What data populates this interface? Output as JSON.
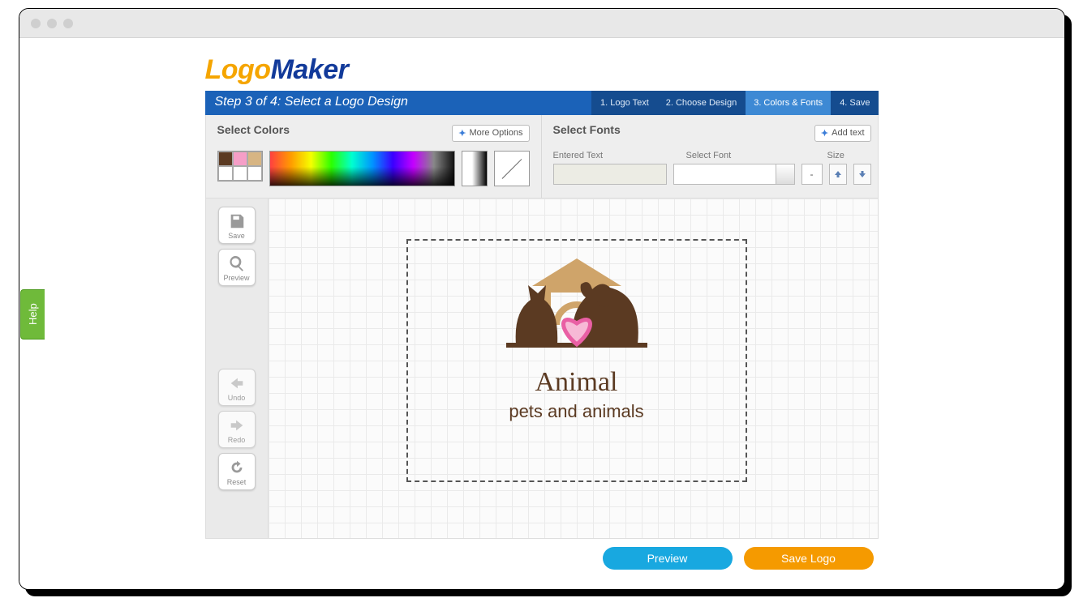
{
  "brand": {
    "part1": "Logo",
    "part2": "Maker"
  },
  "step_title": "Step 3 of 4: Select a Logo Design",
  "steps": [
    {
      "label": "1. Logo Text"
    },
    {
      "label": "2. Choose Design"
    },
    {
      "label": "3. Colors & Fonts",
      "active": true
    },
    {
      "label": "4. Save"
    }
  ],
  "colors_panel": {
    "heading": "Select Colors",
    "more_label": "More Options",
    "swatches": [
      "#5b3a22",
      "#f59ec7",
      "#d7b583"
    ]
  },
  "fonts_panel": {
    "heading": "Select Fonts",
    "add_label": "Add text",
    "entered_text_label": "Entered Text",
    "select_font_label": "Select Font",
    "size_label": "Size",
    "entered_text_value": "",
    "selected_font_value": "",
    "size_value": "-"
  },
  "sidebar": {
    "save": "Save",
    "preview": "Preview",
    "undo": "Undo",
    "redo": "Redo",
    "reset": "Reset"
  },
  "logo": {
    "title": "Animal",
    "tagline": "pets and animals",
    "colors": {
      "main": "#5b3a22",
      "accent_pink": "#f07fb4",
      "accent_tan": "#cfa46a"
    }
  },
  "actions": {
    "preview": "Preview",
    "save": "Save Logo"
  },
  "help": "Help"
}
